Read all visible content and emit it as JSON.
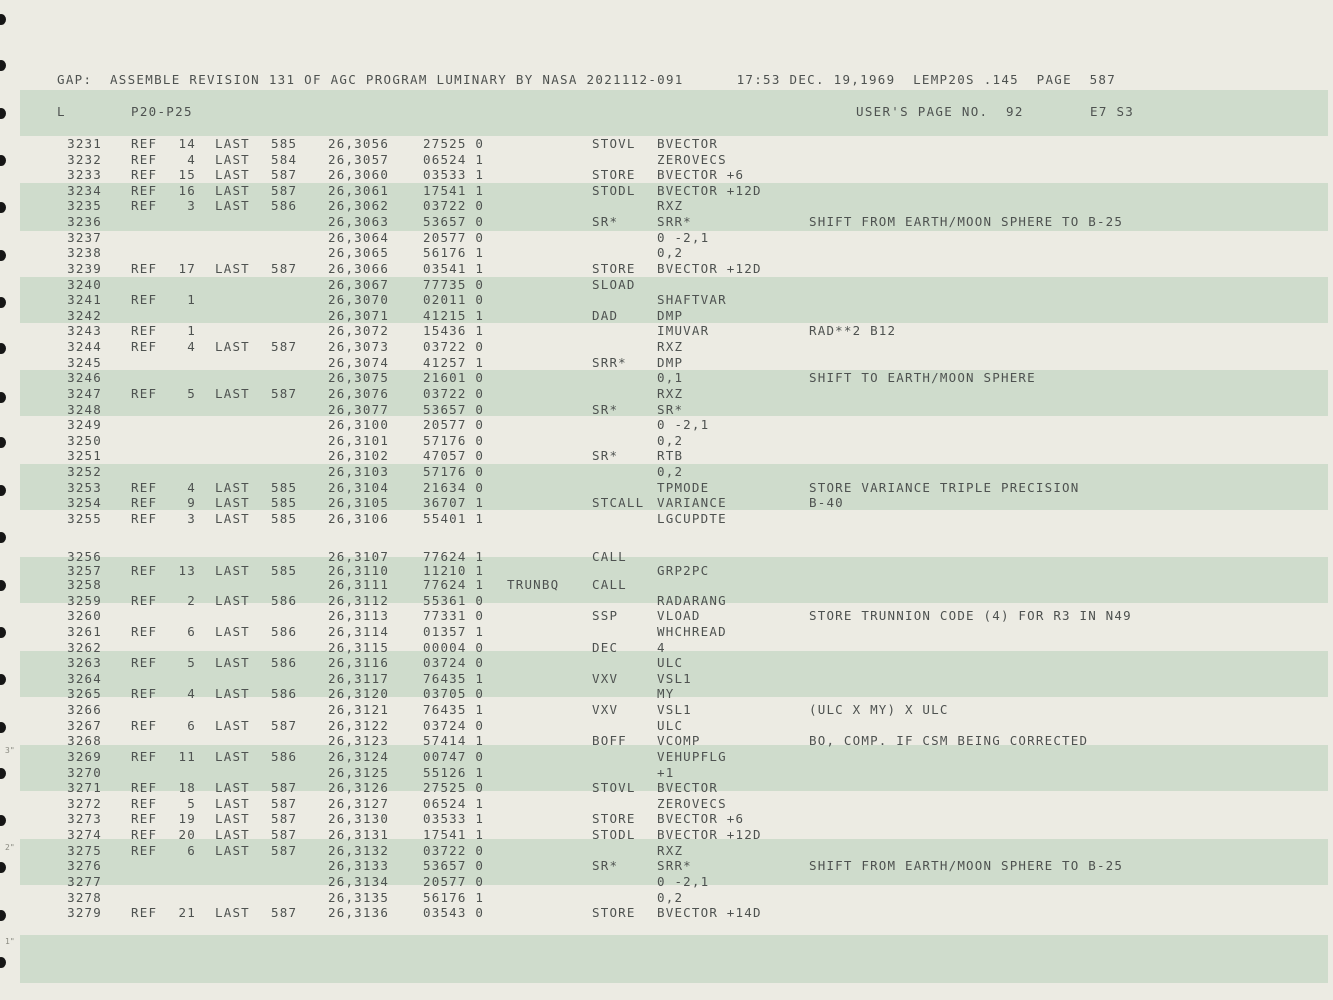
{
  "header": {
    "line": "GAP:  ASSEMBLE REVISION 131 OF AGC PROGRAM LUMINARY BY NASA 2021112-091      17:53 DEC. 19,1969  LEMP20S .145  PAGE  587"
  },
  "subheader": {
    "left_code": "L",
    "section": "P20-P25",
    "user_page": "USER'S PAGE NO.  92",
    "code": "E7 S3"
  },
  "margin_marks": [
    "3\"",
    "2\"",
    "1\""
  ],
  "rows": [
    {
      "ln": "3231",
      "ref": "REF",
      "refn": "14",
      "last": "LAST",
      "lastn": "585",
      "addr": "26,3056",
      "word": "27525 0",
      "label": "",
      "op": "STOVL",
      "opnd": "BVECTOR",
      "cmt": ""
    },
    {
      "ln": "3232",
      "ref": "REF",
      "refn": "4",
      "last": "LAST",
      "lastn": "584",
      "addr": "26,3057",
      "word": "06524 1",
      "label": "",
      "op": "",
      "opnd": "ZEROVECS",
      "cmt": ""
    },
    {
      "ln": "3233",
      "ref": "REF",
      "refn": "15",
      "last": "LAST",
      "lastn": "587",
      "addr": "26,3060",
      "word": "03533 1",
      "label": "",
      "op": "STORE",
      "opnd": "BVECTOR +6",
      "cmt": ""
    },
    {
      "ln": "3234",
      "ref": "REF",
      "refn": "16",
      "last": "LAST",
      "lastn": "587",
      "addr": "26,3061",
      "word": "17541 1",
      "label": "",
      "op": "STODL",
      "opnd": "BVECTOR +12D",
      "cmt": ""
    },
    {
      "ln": "3235",
      "ref": "REF",
      "refn": "3",
      "last": "LAST",
      "lastn": "586",
      "addr": "26,3062",
      "word": "03722 0",
      "label": "",
      "op": "",
      "opnd": "RXZ",
      "cmt": ""
    },
    {
      "ln": "3236",
      "ref": "",
      "refn": "",
      "last": "",
      "lastn": "",
      "addr": "26,3063",
      "word": "53657 0",
      "label": "",
      "op": "SR*",
      "opnd": "SRR*",
      "cmt": "SHIFT FROM EARTH/MOON SPHERE TO B-25"
    },
    {
      "ln": "3237",
      "ref": "",
      "refn": "",
      "last": "",
      "lastn": "",
      "addr": "26,3064",
      "word": "20577 0",
      "label": "",
      "op": "",
      "opnd": "0 -2,1",
      "cmt": ""
    },
    {
      "ln": "3238",
      "ref": "",
      "refn": "",
      "last": "",
      "lastn": "",
      "addr": "26,3065",
      "word": "56176 1",
      "label": "",
      "op": "",
      "opnd": "0,2",
      "cmt": ""
    },
    {
      "ln": "3239",
      "ref": "REF",
      "refn": "17",
      "last": "LAST",
      "lastn": "587",
      "addr": "26,3066",
      "word": "03541 1",
      "label": "",
      "op": "STORE",
      "opnd": "BVECTOR +12D",
      "cmt": ""
    },
    {
      "ln": "3240",
      "ref": "",
      "refn": "",
      "last": "",
      "lastn": "",
      "addr": "26,3067",
      "word": "77735 0",
      "label": "",
      "op": "SLOAD",
      "opnd": "",
      "cmt": ""
    },
    {
      "ln": "3241",
      "ref": "REF",
      "refn": "1",
      "last": "",
      "lastn": "",
      "addr": "26,3070",
      "word": "02011 0",
      "label": "",
      "op": "",
      "opnd": "SHAFTVAR",
      "cmt": ""
    },
    {
      "ln": "3242",
      "ref": "",
      "refn": "",
      "last": "",
      "lastn": "",
      "addr": "26,3071",
      "word": "41215 1",
      "label": "",
      "op": "DAD",
      "opnd": "DMP",
      "cmt": ""
    },
    {
      "ln": "3243",
      "ref": "REF",
      "refn": "1",
      "last": "",
      "lastn": "",
      "addr": "26,3072",
      "word": "15436 1",
      "label": "",
      "op": "",
      "opnd": "IMUVAR",
      "cmt": "RAD**2 B12"
    },
    {
      "ln": "3244",
      "ref": "REF",
      "refn": "4",
      "last": "LAST",
      "lastn": "587",
      "addr": "26,3073",
      "word": "03722 0",
      "label": "",
      "op": "",
      "opnd": "RXZ",
      "cmt": ""
    },
    {
      "ln": "3245",
      "ref": "",
      "refn": "",
      "last": "",
      "lastn": "",
      "addr": "26,3074",
      "word": "41257 1",
      "label": "",
      "op": "SRR*",
      "opnd": "DMP",
      "cmt": ""
    },
    {
      "ln": "3246",
      "ref": "",
      "refn": "",
      "last": "",
      "lastn": "",
      "addr": "26,3075",
      "word": "21601 0",
      "label": "",
      "op": "",
      "opnd": "0,1",
      "cmt": "SHIFT TO EARTH/MOON SPHERE"
    },
    {
      "ln": "3247",
      "ref": "REF",
      "refn": "5",
      "last": "LAST",
      "lastn": "587",
      "addr": "26,3076",
      "word": "03722 0",
      "label": "",
      "op": "",
      "opnd": "RXZ",
      "cmt": ""
    },
    {
      "ln": "3248",
      "ref": "",
      "refn": "",
      "last": "",
      "lastn": "",
      "addr": "26,3077",
      "word": "53657 0",
      "label": "",
      "op": "SR*",
      "opnd": "SR*",
      "cmt": ""
    },
    {
      "ln": "3249",
      "ref": "",
      "refn": "",
      "last": "",
      "lastn": "",
      "addr": "26,3100",
      "word": "20577 0",
      "label": "",
      "op": "",
      "opnd": "0 -2,1",
      "cmt": ""
    },
    {
      "ln": "3250",
      "ref": "",
      "refn": "",
      "last": "",
      "lastn": "",
      "addr": "26,3101",
      "word": "57176 0",
      "label": "",
      "op": "",
      "opnd": "0,2",
      "cmt": ""
    },
    {
      "ln": "3251",
      "ref": "",
      "refn": "",
      "last": "",
      "lastn": "",
      "addr": "26,3102",
      "word": "47057 0",
      "label": "",
      "op": "SR*",
      "opnd": "RTB",
      "cmt": ""
    },
    {
      "ln": "3252",
      "ref": "",
      "refn": "",
      "last": "",
      "lastn": "",
      "addr": "26,3103",
      "word": "57176 0",
      "label": "",
      "op": "",
      "opnd": "0,2",
      "cmt": ""
    },
    {
      "ln": "3253",
      "ref": "REF",
      "refn": "4",
      "last": "LAST",
      "lastn": "585",
      "addr": "26,3104",
      "word": "21634 0",
      "label": "",
      "op": "",
      "opnd": "TPMODE",
      "cmt": "STORE VARIANCE TRIPLE PRECISION"
    },
    {
      "ln": "3254",
      "ref": "REF",
      "refn": "9",
      "last": "LAST",
      "lastn": "585",
      "addr": "26,3105",
      "word": "36707 1",
      "label": "",
      "op": "STCALL",
      "opnd": "VARIANCE",
      "cmt": "B-40"
    },
    {
      "ln": "3255",
      "ref": "REF",
      "refn": "3",
      "last": "LAST",
      "lastn": "585",
      "addr": "26,3106",
      "word": "55401 1",
      "label": "",
      "op": "",
      "opnd": "LGCUPDTE",
      "cmt": ""
    },
    {
      "ln": "3256",
      "ref": "",
      "refn": "",
      "last": "",
      "lastn": "",
      "addr": "26,3107",
      "word": "77624 1",
      "label": "",
      "op": "CALL",
      "opnd": "",
      "cmt": ""
    },
    {
      "ln": "3257",
      "ref": "REF",
      "refn": "13",
      "last": "LAST",
      "lastn": "585",
      "addr": "26,3110",
      "word": "11210 1",
      "label": "",
      "op": "",
      "opnd": "GRP2PC",
      "cmt": ""
    },
    {
      "ln": "3258",
      "ref": "",
      "refn": "",
      "last": "",
      "lastn": "",
      "addr": "26,3111",
      "word": "77624 1",
      "label": "TRUNBQ",
      "op": "CALL",
      "opnd": "",
      "cmt": ""
    },
    {
      "ln": "3259",
      "ref": "REF",
      "refn": "2",
      "last": "LAST",
      "lastn": "586",
      "addr": "26,3112",
      "word": "55361 0",
      "label": "",
      "op": "",
      "opnd": "RADARANG",
      "cmt": ""
    },
    {
      "ln": "3260",
      "ref": "",
      "refn": "",
      "last": "",
      "lastn": "",
      "addr": "26,3113",
      "word": "77331 0",
      "label": "",
      "op": "SSP",
      "opnd": "VLOAD",
      "cmt": "STORE TRUNNION CODE (4) FOR R3 IN N49"
    },
    {
      "ln": "3261",
      "ref": "REF",
      "refn": "6",
      "last": "LAST",
      "lastn": "586",
      "addr": "26,3114",
      "word": "01357 1",
      "label": "",
      "op": "",
      "opnd": "WHCHREAD",
      "cmt": ""
    },
    {
      "ln": "3262",
      "ref": "",
      "refn": "",
      "last": "",
      "lastn": "",
      "addr": "26,3115",
      "word": "00004 0",
      "label": "",
      "op": "DEC",
      "opnd": "4",
      "cmt": ""
    },
    {
      "ln": "3263",
      "ref": "REF",
      "refn": "5",
      "last": "LAST",
      "lastn": "586",
      "addr": "26,3116",
      "word": "03724 0",
      "label": "",
      "op": "",
      "opnd": "ULC",
      "cmt": ""
    },
    {
      "ln": "3264",
      "ref": "",
      "refn": "",
      "last": "",
      "lastn": "",
      "addr": "26,3117",
      "word": "76435 1",
      "label": "",
      "op": "VXV",
      "opnd": "VSL1",
      "cmt": ""
    },
    {
      "ln": "3265",
      "ref": "REF",
      "refn": "4",
      "last": "LAST",
      "lastn": "586",
      "addr": "26,3120",
      "word": "03705 0",
      "label": "",
      "op": "",
      "opnd": "MY",
      "cmt": ""
    },
    {
      "ln": "3266",
      "ref": "",
      "refn": "",
      "last": "",
      "lastn": "",
      "addr": "26,3121",
      "word": "76435 1",
      "label": "",
      "op": "VXV",
      "opnd": "VSL1",
      "cmt": "(ULC X MY) X ULC"
    },
    {
      "ln": "3267",
      "ref": "REF",
      "refn": "6",
      "last": "LAST",
      "lastn": "587",
      "addr": "26,3122",
      "word": "03724 0",
      "label": "",
      "op": "",
      "opnd": "ULC",
      "cmt": ""
    },
    {
      "ln": "3268",
      "ref": "",
      "refn": "",
      "last": "",
      "lastn": "",
      "addr": "26,3123",
      "word": "57414 1",
      "label": "",
      "op": "BOFF",
      "opnd": "VCOMP",
      "cmt": "BO, COMP. IF CSM BEING CORRECTED"
    },
    {
      "ln": "3269",
      "ref": "REF",
      "refn": "11",
      "last": "LAST",
      "lastn": "586",
      "addr": "26,3124",
      "word": "00747 0",
      "label": "",
      "op": "",
      "opnd": "VEHUPFLG",
      "cmt": ""
    },
    {
      "ln": "3270",
      "ref": "",
      "refn": "",
      "last": "",
      "lastn": "",
      "addr": "26,3125",
      "word": "55126 1",
      "label": "",
      "op": "",
      "opnd": "+1",
      "cmt": ""
    },
    {
      "ln": "3271",
      "ref": "REF",
      "refn": "18",
      "last": "LAST",
      "lastn": "587",
      "addr": "26,3126",
      "word": "27525 0",
      "label": "",
      "op": "STOVL",
      "opnd": "BVECTOR",
      "cmt": ""
    },
    {
      "ln": "3272",
      "ref": "REF",
      "refn": "5",
      "last": "LAST",
      "lastn": "587",
      "addr": "26,3127",
      "word": "06524 1",
      "label": "",
      "op": "",
      "opnd": "ZEROVECS",
      "cmt": ""
    },
    {
      "ln": "3273",
      "ref": "REF",
      "refn": "19",
      "last": "LAST",
      "lastn": "587",
      "addr": "26,3130",
      "word": "03533 1",
      "label": "",
      "op": "STORE",
      "opnd": "BVECTOR +6",
      "cmt": ""
    },
    {
      "ln": "3274",
      "ref": "REF",
      "refn": "20",
      "last": "LAST",
      "lastn": "587",
      "addr": "26,3131",
      "word": "17541 1",
      "label": "",
      "op": "STODL",
      "opnd": "BVECTOR +12D",
      "cmt": ""
    },
    {
      "ln": "3275",
      "ref": "REF",
      "refn": "6",
      "last": "LAST",
      "lastn": "587",
      "addr": "26,3132",
      "word": "03722 0",
      "label": "",
      "op": "",
      "opnd": "RXZ",
      "cmt": ""
    },
    {
      "ln": "3276",
      "ref": "",
      "refn": "",
      "last": "",
      "lastn": "",
      "addr": "26,3133",
      "word": "53657 0",
      "label": "",
      "op": "SR*",
      "opnd": "SRR*",
      "cmt": "SHIFT FROM EARTH/MOON SPHERE TO B-25"
    },
    {
      "ln": "3277",
      "ref": "",
      "refn": "",
      "last": "",
      "lastn": "",
      "addr": "26,3134",
      "word": "20577 0",
      "label": "",
      "op": "",
      "opnd": "0 -2,1",
      "cmt": ""
    },
    {
      "ln": "3278",
      "ref": "",
      "refn": "",
      "last": "",
      "lastn": "",
      "addr": "26,3135",
      "word": "56176 1",
      "label": "",
      "op": "",
      "opnd": "0,2",
      "cmt": ""
    },
    {
      "ln": "3279",
      "ref": "REF",
      "refn": "21",
      "last": "LAST",
      "lastn": "587",
      "addr": "26,3136",
      "word": "03543 0",
      "label": "",
      "op": "STORE",
      "opnd": "BVECTOR +14D",
      "cmt": ""
    }
  ]
}
